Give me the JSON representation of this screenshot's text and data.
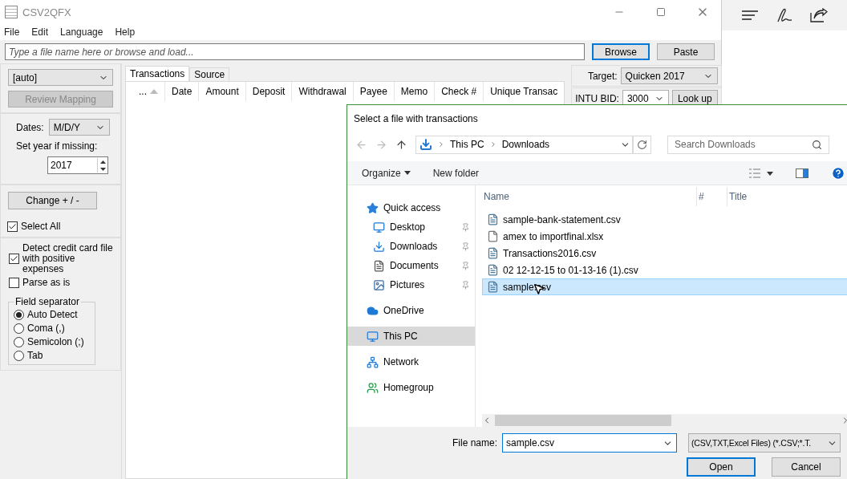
{
  "main_window": {
    "title": "CSV2QFX",
    "menu": [
      "File",
      "Edit",
      "Language",
      "Help"
    ],
    "file_input": {
      "placeholder": "Type a file name here or browse and load..."
    },
    "file_buttons": [
      {
        "label": "Browse",
        "focused": true
      },
      {
        "label": "Paste",
        "focused": false
      }
    ],
    "left_panel": {
      "mapping_select": "[auto]",
      "review_button": {
        "label": "Review Mapping",
        "disabled": true
      },
      "dates_label": "Dates:",
      "dates_select": "M/D/Y",
      "year_label": "Set year if missing:",
      "year_value": "2017",
      "change_button": "Change + / -",
      "select_all": {
        "label": "Select All",
        "checked": true
      },
      "options": [
        {
          "label": "Detect credit card file with positive expenses",
          "checked": true
        },
        {
          "label": "Parse as is",
          "checked": false
        }
      ],
      "field_separator": {
        "legend": "Field separator",
        "options": [
          {
            "label": "Auto Detect",
            "selected": true
          },
          {
            "label": "Coma (,)",
            "selected": false
          },
          {
            "label": "Semicolon (;)",
            "selected": false
          },
          {
            "label": "Tab",
            "selected": false
          }
        ]
      }
    },
    "tabs": [
      {
        "label": "Transactions",
        "selected": true
      },
      {
        "label": "Source",
        "selected": false
      }
    ],
    "columns": [
      {
        "label": "...",
        "sorted": true
      },
      {
        "label": "Date",
        "sorted": false
      },
      {
        "label": "Amount",
        "sorted": false
      },
      {
        "label": "Deposit",
        "sorted": false
      },
      {
        "label": "Withdrawal",
        "sorted": false
      },
      {
        "label": "Payee",
        "sorted": false
      },
      {
        "label": "Memo",
        "sorted": false
      },
      {
        "label": "Check #",
        "sorted": false
      },
      {
        "label": "Unique Transac",
        "sorted": false
      }
    ],
    "right_panel": {
      "target_label": "Target:",
      "target_value": "Quicken 2017",
      "bid_label": "INTU BID:",
      "bid_value": "3000",
      "lookup_button": "Look up"
    }
  },
  "dialog": {
    "title": "Select a file with transactions",
    "breadcrumb": [
      "This PC",
      "Downloads"
    ],
    "search": {
      "placeholder": "Search Downloads"
    },
    "toolbar": {
      "organize": "Organize",
      "new_folder": "New folder"
    },
    "nav": [
      {
        "label": "Quick access",
        "kind": "star",
        "selected": false,
        "children": [
          {
            "label": "Desktop",
            "kind": "desktop",
            "pinned": true,
            "selected": false
          },
          {
            "label": "Downloads",
            "kind": "downloads",
            "pinned": true,
            "selected": false
          },
          {
            "label": "Documents",
            "kind": "documents",
            "pinned": true,
            "selected": false
          },
          {
            "label": "Pictures",
            "kind": "pictures",
            "pinned": true,
            "selected": false
          }
        ]
      },
      {
        "label": "OneDrive",
        "kind": "cloud",
        "selected": false
      },
      {
        "label": "This PC",
        "kind": "pc",
        "selected": true
      },
      {
        "label": "Network",
        "kind": "network",
        "selected": false
      },
      {
        "label": "Homegroup",
        "kind": "homegroup",
        "selected": false
      }
    ],
    "columns": [
      "Name",
      "#",
      "Title"
    ],
    "files": [
      {
        "name": "sample-bank-statement.csv",
        "kind": "text-file",
        "selected": false
      },
      {
        "name": "amex to importfinal.xlsx",
        "kind": "blank-file",
        "selected": false
      },
      {
        "name": "Transactions2016.csv",
        "kind": "text-file",
        "selected": false
      },
      {
        "name": "02 12-12-15 to 01-13-16 (1).csv",
        "kind": "text-file",
        "selected": false
      },
      {
        "name": "sample.csv",
        "kind": "text-file",
        "selected": true
      }
    ],
    "file_name_label": "File name:",
    "file_name_value": "sample.csv",
    "file_type": "(CSV,TXT,Excel Files) (*.CSV;*.T.",
    "buttons": [
      {
        "label": "Open",
        "default": true
      },
      {
        "label": "Cancel",
        "default": false
      }
    ]
  }
}
